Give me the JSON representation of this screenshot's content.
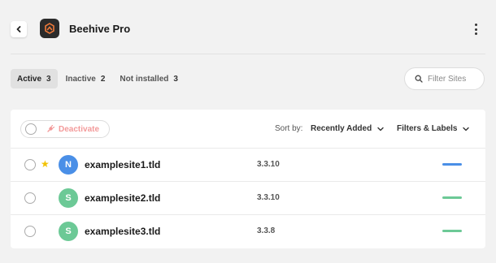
{
  "header": {
    "title": "Beehive Pro",
    "back_icon": "chevron-left-icon",
    "logo_icon": "beehive-logo-icon",
    "menu_icon": "kebab-menu-icon"
  },
  "tabs": [
    {
      "label": "Active",
      "count": "3",
      "active": true
    },
    {
      "label": "Inactive",
      "count": "2",
      "active": false
    },
    {
      "label": "Not installed",
      "count": "3",
      "active": false
    }
  ],
  "search": {
    "placeholder": "Filter Sites",
    "value": "",
    "icon": "search-icon"
  },
  "toolbar": {
    "deactivate_label": "Deactivate",
    "deactivate_icon": "plug-icon",
    "sort_label": "Sort by:",
    "sort_value": "Recently Added",
    "filters_label": "Filters & Labels"
  },
  "sites": [
    {
      "name": "examplesite1.tld",
      "initial": "N",
      "avatar_color": "#4a8fe7",
      "version": "3.3.10",
      "starred": true,
      "status_color": "#4a8fe7"
    },
    {
      "name": "examplesite2.tld",
      "initial": "S",
      "avatar_color": "#6cc996",
      "version": "3.3.10",
      "starred": false,
      "status_color": "#6cc996"
    },
    {
      "name": "examplesite3.tld",
      "initial": "S",
      "avatar_color": "#6cc996",
      "version": "3.3.8",
      "starred": false,
      "status_color": "#6cc996"
    }
  ],
  "colors": {
    "accent_orange": "#f07a3a",
    "danger_soft": "#f39a9a",
    "star": "#f2c200"
  }
}
